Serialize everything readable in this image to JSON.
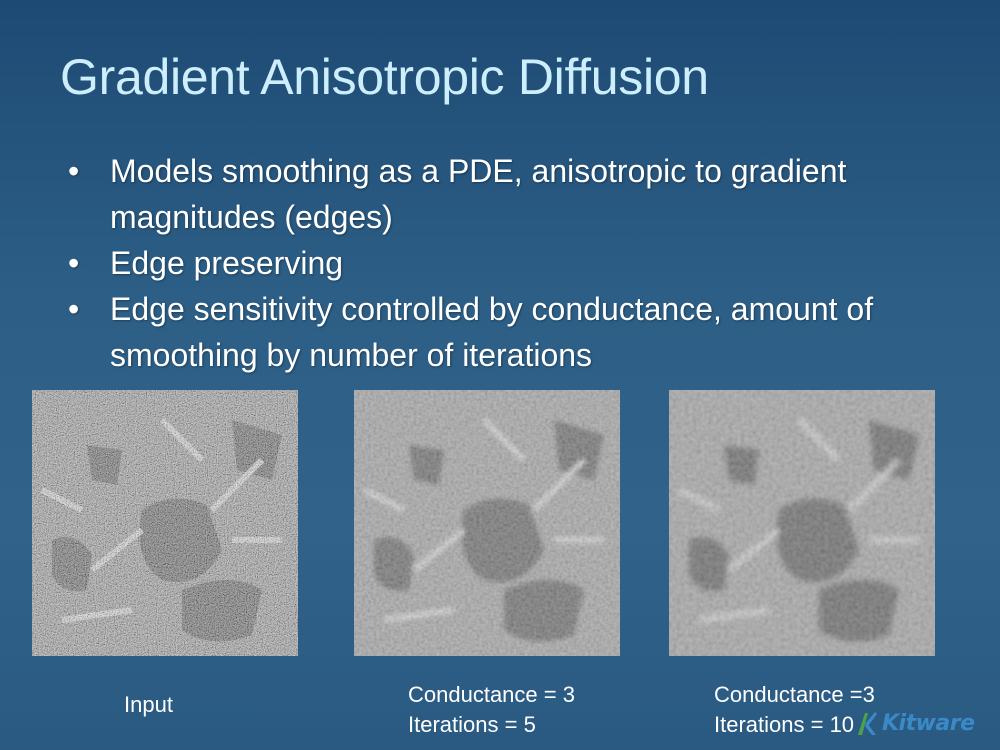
{
  "slide": {
    "title": "Gradient Anisotropic Diffusion",
    "bullets": [
      "Models smoothing as a PDE, anisotropic to gradient magnitudes (edges)",
      "Edge preserving",
      "Edge sensitivity controlled by conductance, amount of smoothing by number of iterations"
    ]
  },
  "images": [
    {
      "name": "input-image",
      "caption_lines": [
        "Input"
      ]
    },
    {
      "name": "conductance-3-iterations-5-image",
      "caption_lines": [
        "Conductance = 3",
        "Iterations = 5"
      ]
    },
    {
      "name": "conductance-3-iterations-10-image",
      "caption_lines": [
        "Conductance =3",
        "Iterations = 10"
      ]
    }
  ],
  "logo": {
    "text": "Kitware",
    "icon": "kitware-logo-icon",
    "color": "#3a8ac8"
  },
  "colors": {
    "title": "#cdeefc",
    "text": "#ffffff",
    "background_top": "#1d4a74",
    "background_bottom": "#2a5a82"
  }
}
